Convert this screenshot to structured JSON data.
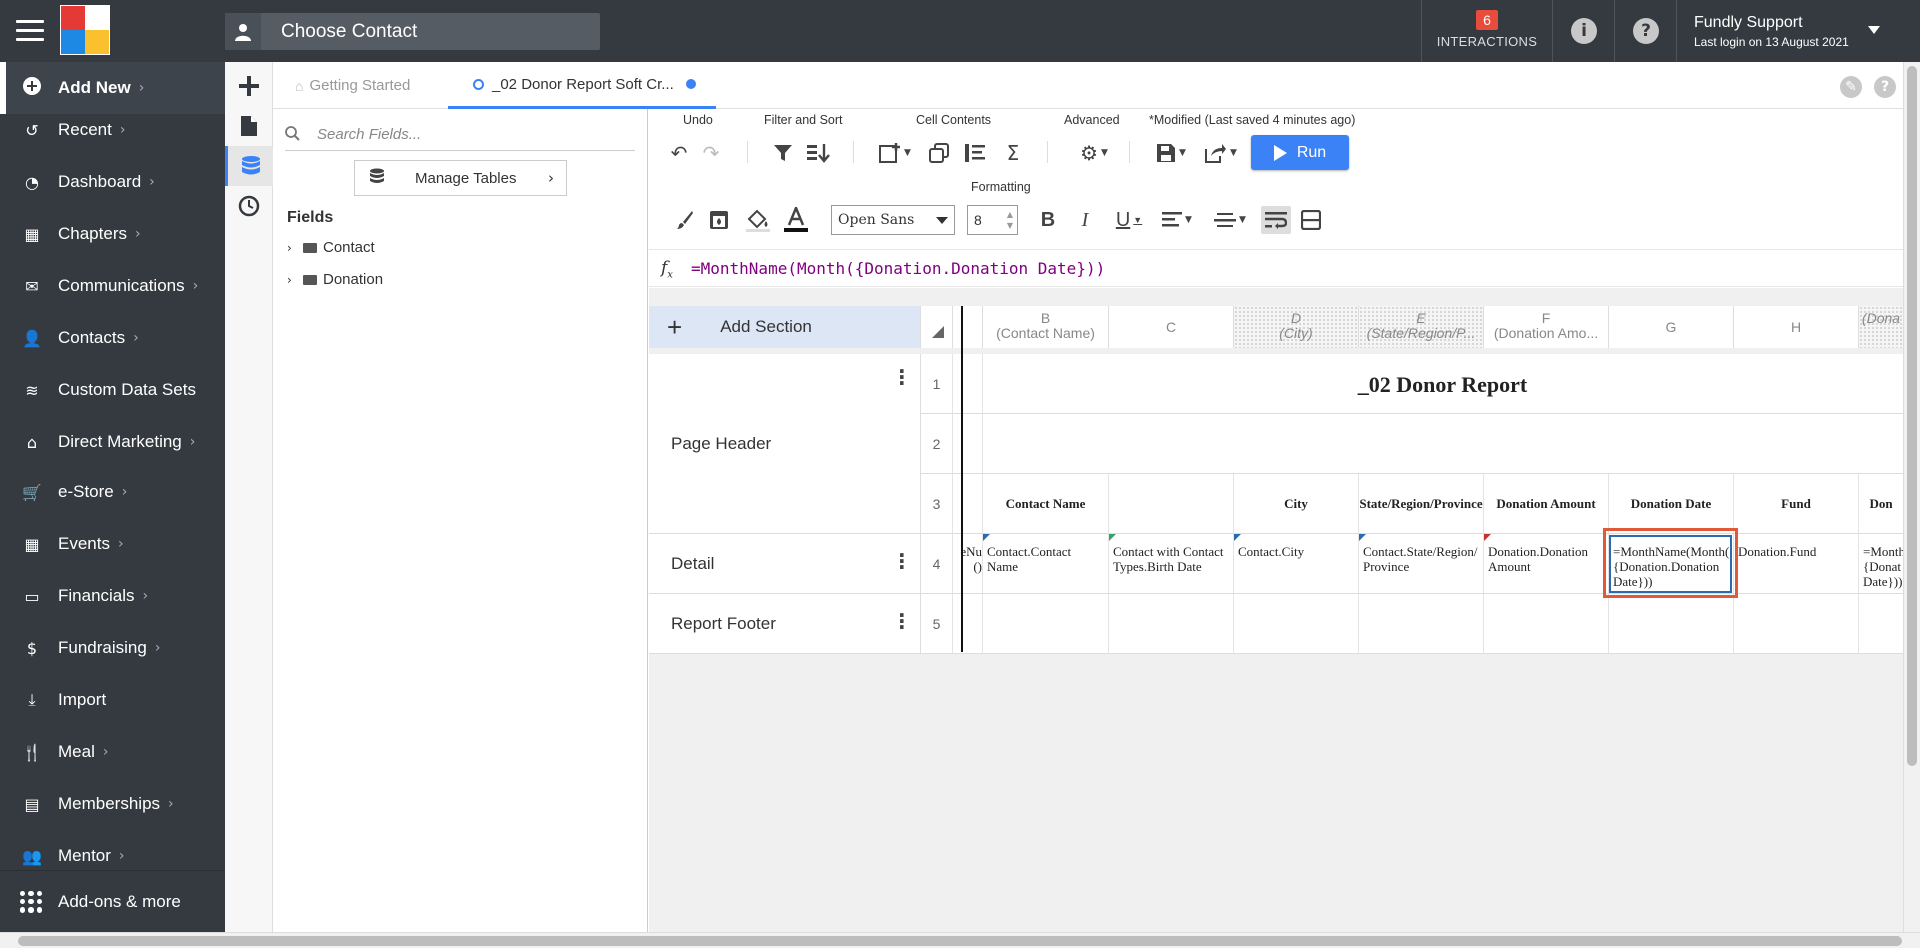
{
  "topbar": {
    "choose_contact": "Choose Contact",
    "interactions_count": "6",
    "interactions_label": "INTERACTIONS",
    "user_name": "Fundly Support",
    "last_login": "Last login on 13 August 2021"
  },
  "sidebar": {
    "add_new": "Add New",
    "items": [
      {
        "label": "Recent",
        "icon": "history-icon"
      },
      {
        "label": "Dashboard",
        "icon": "dashboard-icon"
      },
      {
        "label": "Chapters",
        "icon": "grid-icon"
      },
      {
        "label": "Communications",
        "icon": "envelope-icon"
      },
      {
        "label": "Contacts",
        "icon": "user-icon"
      },
      {
        "label": "Custom Data Sets",
        "icon": "layers-icon"
      },
      {
        "label": "Direct Marketing",
        "icon": "bank-icon"
      },
      {
        "label": "e-Store",
        "icon": "cart-icon"
      },
      {
        "label": "Events",
        "icon": "calendar-icon"
      },
      {
        "label": "Financials",
        "icon": "money-icon"
      },
      {
        "label": "Fundraising",
        "icon": "moneybag-icon"
      },
      {
        "label": "Import",
        "icon": "import-icon"
      },
      {
        "label": "Meal",
        "icon": "utensils-icon"
      },
      {
        "label": "Memberships",
        "icon": "id-card-icon"
      },
      {
        "label": "Mentor",
        "icon": "people-icon"
      }
    ],
    "addons": "Add-ons & more"
  },
  "tabs": {
    "getting_started": "Getting Started",
    "donor_report": "_02 Donor Report Soft Cr..."
  },
  "fields_panel": {
    "search_placeholder": "Search Fields...",
    "manage_tables": "Manage Tables",
    "fields_title": "Fields",
    "tree": [
      "Contact",
      "Donation"
    ]
  },
  "toolbar": {
    "undo_label": "Undo",
    "filter_sort_label": "Filter and Sort",
    "cell_contents_label": "Cell Contents",
    "advanced_label": "Advanced",
    "modified_label": "*Modified (Last saved 4 minutes ago)",
    "run_label": "Run",
    "formatting_label": "Formatting",
    "font_name": "Open Sans",
    "font_size": "8"
  },
  "formula_bar": {
    "formula": "=MonthName(Month({Donation.Donation Date}))"
  },
  "sheet": {
    "add_section": "Add Section",
    "columns": [
      {
        "letter": "",
        "sub": ""
      },
      {
        "letter": "B",
        "sub": "(Contact Name)"
      },
      {
        "letter": "C",
        "sub": ""
      },
      {
        "letter": "D",
        "sub": "(City)"
      },
      {
        "letter": "E",
        "sub": "(State/Region/P..."
      },
      {
        "letter": "F",
        "sub": "(Donation Amo..."
      },
      {
        "letter": "G",
        "sub": ""
      },
      {
        "letter": "H",
        "sub": ""
      },
      {
        "letter": "",
        "sub": "(Dona"
      }
    ],
    "sections": [
      "Page Header",
      "Detail",
      "Report Footer"
    ],
    "row_numbers": [
      "1",
      "2",
      "3",
      "4",
      "5"
    ],
    "title": "_02 Donor Report",
    "headers": [
      "Contact Name",
      "",
      "City",
      "State/Region/Province",
      "Donation Amount",
      "Donation Date",
      "Fund",
      "Don"
    ],
    "detail": [
      "eNu ()",
      "Contact.Contact Name",
      "Contact with Contact Types.Birth Date",
      "Contact.City",
      "Contact.State/Region/ Province",
      "Donation.Donation Amount",
      "=MonthName(Month( {Donation.Donation Date}))",
      "Donation.Fund",
      "=Month {Donat Date}))"
    ]
  },
  "colors": {
    "sidebar_bg": "#343a40",
    "accent": "#3b82f6",
    "highlight": "#e05a3a"
  }
}
